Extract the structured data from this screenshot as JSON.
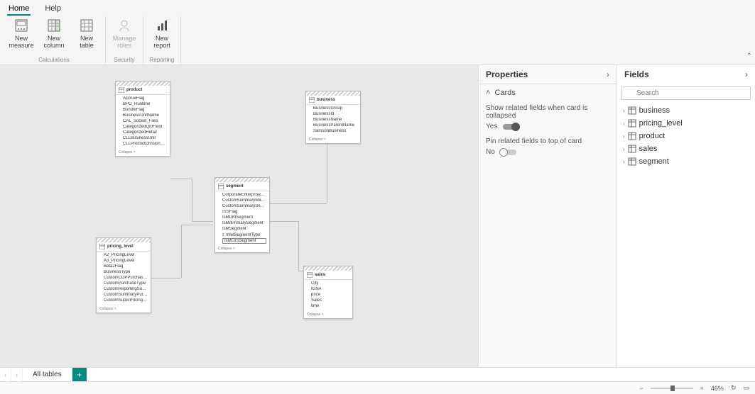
{
  "menu": {
    "home": "Home",
    "help": "Help"
  },
  "ribbon": {
    "calculations_label": "Calculations",
    "new_measure": "New\nmeasure",
    "new_column": "New\ncolumn",
    "new_table": "New\ntable",
    "security_label": "Security",
    "manage_roles": "Manage\nroles",
    "reporting_label": "Reporting",
    "new_report": "New\nreport"
  },
  "canvas": {
    "collapse_label": "Collapse",
    "cards": {
      "product": {
        "title": "product",
        "fields": [
          "AccrueFlag",
          "BPO_Runtime",
          "BundleFlag",
          "BusinessUnitName",
          "CAL_Socket_Files",
          "CategorizedQI0Field",
          "CategorizedRetail",
          "CLLBusinessUnit",
          "CLLProductDivisionAndServices"
        ]
      },
      "business": {
        "title": "business",
        "fields": [
          "BusinessGroup",
          "BusinessId",
          "BusinessName",
          "BusinessParentName",
          "SamsonBusiness"
        ]
      },
      "segment": {
        "title": "segment",
        "fields": [
          "CorporateEnterpriseFlag",
          "CustomSummaryMarket",
          "CustomSummarySegment",
          "ISSFlag",
          "IsMDMSegment",
          "IsMdPrimarySegment",
          "IsMSegment",
          "IntelSegmentType",
          "IsMLoSSegment"
        ]
      },
      "pricing_level": {
        "title": "pricing_level",
        "fields": [
          "A2_PricingLevel",
          "A3_PricingLevel",
          "Beta2Flag",
          "BusinessType",
          "CustomCDPPurchaseType",
          "CustomPurchaseType",
          "CustomReportingSummaryPur…",
          "CustomSummaryPurchaseType",
          "CustomSuperPricingLevel"
        ]
      },
      "sales": {
        "title": "sales",
        "fields": [
          "City",
          "IGNA",
          "price",
          "Sales",
          "time"
        ]
      }
    }
  },
  "properties": {
    "title": "Properties",
    "section_cards": "Cards",
    "related_label": "Show related fields when card is collapsed",
    "related_value": "Yes",
    "pin_label": "Pin related fields to top of card",
    "pin_value": "No"
  },
  "fields": {
    "title": "Fields",
    "search_placeholder": "Search",
    "items": [
      "business",
      "pricing_level",
      "product",
      "sales",
      "segment"
    ]
  },
  "tabs": {
    "all_tables": "All tables"
  },
  "status": {
    "zoom_text": "46%",
    "minus": "−",
    "plus": "+"
  }
}
